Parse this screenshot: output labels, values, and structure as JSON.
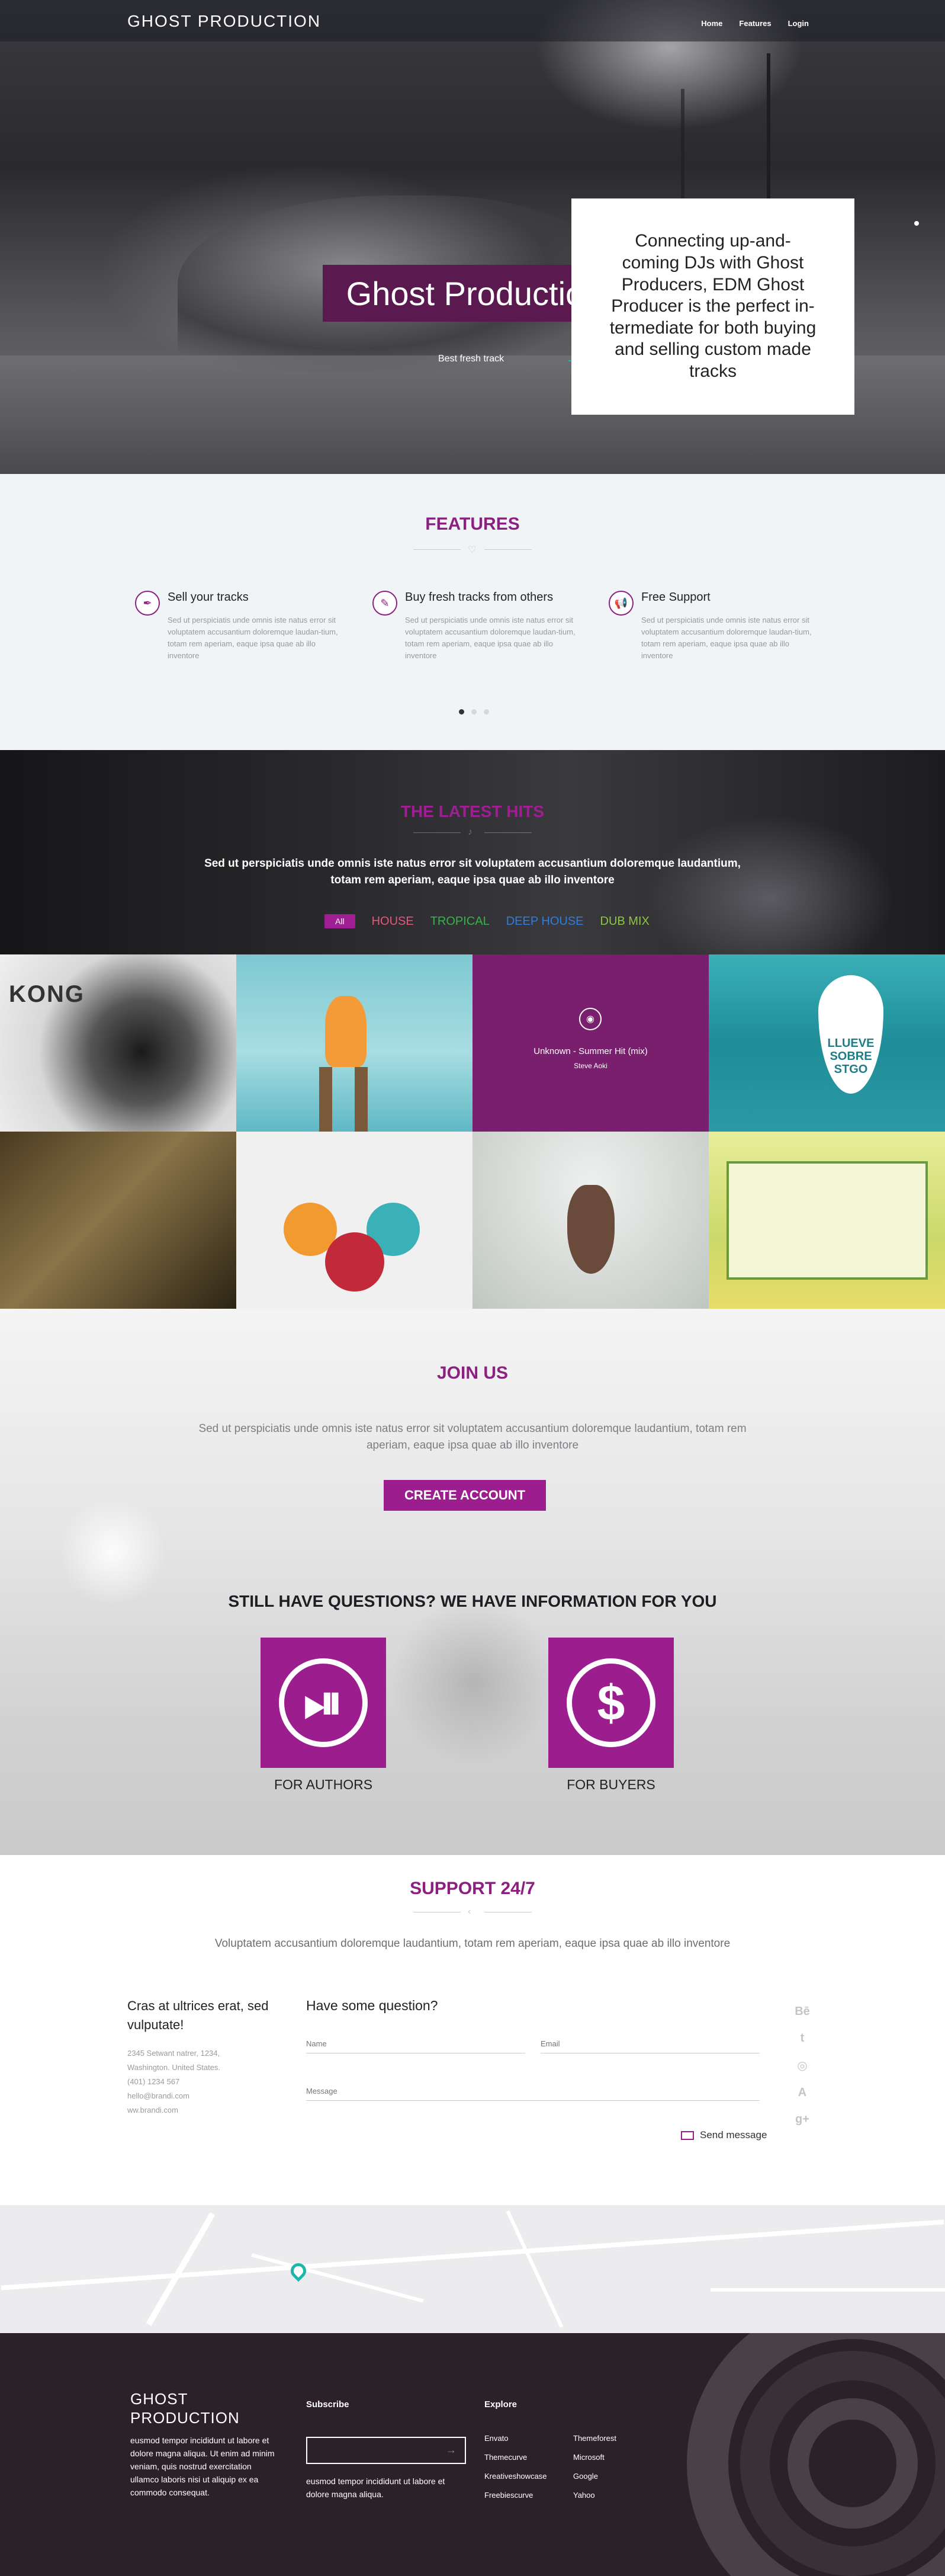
{
  "header": {
    "logo": "GHOST  PRODUCTION",
    "nav": [
      "Home",
      "Features",
      "Login"
    ]
  },
  "hero": {
    "title": "Ghost Production",
    "subtitle": "Best fresh track",
    "card_text": "Connecting up-and-coming DJs with Ghost Producers, EDM Ghost Producer is the perfect in-termediate for both buying and selling custom made tracks"
  },
  "features": {
    "title": "FEATURES",
    "items": [
      {
        "icon": "pen-icon",
        "title": "Sell your tracks",
        "text": "Sed ut perspiciatis unde omnis iste natus error sit voluptatem accusantium doloremque laudan-tium, totam rem aperiam, eaque ipsa quae ab illo inventore"
      },
      {
        "icon": "pencil-icon",
        "title": "Buy fresh tracks from others",
        "text": "Sed ut perspiciatis unde omnis iste natus error sit voluptatem accusantium doloremque laudan-tium, totam rem aperiam, eaque ipsa quae ab illo inventore"
      },
      {
        "icon": "megaphone-icon",
        "title": "Free Support",
        "text": "Sed ut perspiciatis unde omnis iste natus error sit voluptatem accusantium doloremque laudan-tium, totam rem aperiam, eaque ipsa quae ab illo inventore"
      }
    ],
    "slider_pages": 3,
    "slider_active": 1
  },
  "latest_hits": {
    "title": "THE LATEST HITS",
    "text": "Sed ut perspiciatis unde omnis iste natus error sit voluptatem accusantium doloremque laudantium, totam rem aperiam, eaque ipsa quae ab illo inventore",
    "filters": [
      "All",
      "HOUSE",
      "TROPICAL",
      "DEEP HOUSE",
      "DUB MIX"
    ],
    "active_filter": "All",
    "hover_track": {
      "title": "Unknown - Summer Hit (mix)",
      "artist": "Steve Aoki"
    },
    "tile_texts": {
      "kong": "KONG",
      "drop": [
        "LLUEVE",
        "SOBRE",
        "STGO"
      ]
    }
  },
  "join": {
    "title": "JOIN US",
    "text": "Sed ut perspiciatis unde omnis iste natus error sit voluptatem accusantium doloremque laudantium, totam rem aperiam, eaque ipsa quae ab illo inventore",
    "button": "CREATE ACCOUNT",
    "questions_title": "STILL HAVE QUESTIONS?   WE HAVE INFORMATION FOR YOU",
    "for_authors": "FOR AUTHORS",
    "for_buyers": "FOR BUYERS"
  },
  "support": {
    "title": "SUPPORT 24/7",
    "text": "Voluptatem accusantium doloremque laudantium, totam rem aperiam, eaque ipsa quae ab illo inventore",
    "left_heading": "Cras at ultrices erat, sed vulputate!",
    "address": [
      "2345 Setwant natrer, 1234,",
      "Washington. United States.",
      "(401) 1234 567",
      "hello@brandi.com",
      "ww.brandi.com"
    ],
    "form_title": "Have some question?",
    "name_placeholder": "Name",
    "email_placeholder": "Email",
    "message_placeholder": "Message",
    "send_label": "Send message",
    "social": [
      "Bē",
      "t",
      "◎",
      "A",
      "g+"
    ]
  },
  "footer": {
    "logo_line1": "GHOST",
    "logo_line2": "PRODUCTION",
    "about": "eusmod tempor incididunt ut labore et dolore magna aliqua. Ut enim ad minim veniam, quis nostrud exercitation ullamco laboris nisi ut aliquip ex ea commodo consequat.",
    "subscribe_title": "Subscribe",
    "subscribe_text": "eusmod tempor incididunt ut labore et dolore magna aliqua.",
    "explore_title": "Explore",
    "explore_col1": [
      "Envato",
      "Themecurve",
      "Kreativeshowcase",
      "Freebiescurve"
    ],
    "explore_col2": [
      "Themeforest",
      "Microsoft",
      "Google",
      "Yahoo"
    ]
  },
  "colors": {
    "accent": "#8c1f82",
    "hero_title_bg": "#5a1a50",
    "footer_bg": "#2b2229",
    "teal": "#1db7a9"
  }
}
